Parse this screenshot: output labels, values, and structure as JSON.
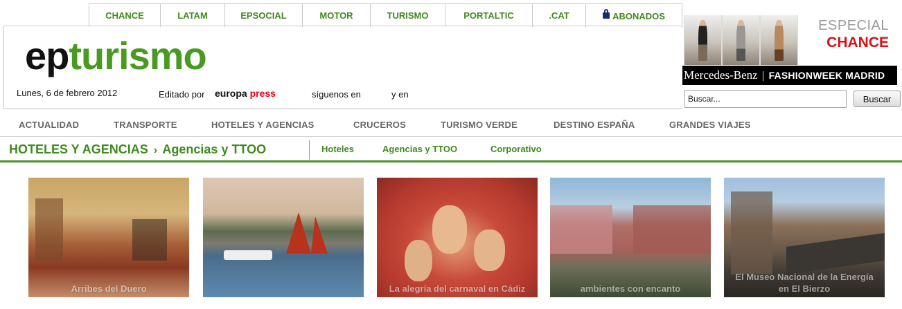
{
  "top_tabs": [
    {
      "label": "CHANCE"
    },
    {
      "label": "LATAM"
    },
    {
      "label": "EPSOCIAL"
    },
    {
      "label": "MOTOR"
    },
    {
      "label": "TURISMO"
    },
    {
      "label": "PORTALTIC"
    },
    {
      "label": ".CAT"
    },
    {
      "label": "ABONADOS",
      "icon": "lock-icon"
    }
  ],
  "header": {
    "logo_ep": "ep",
    "logo_turismo": "turismo",
    "date": "Lunes, 6 de febrero 2012",
    "edited_by": "Editado por",
    "brand_europa": "europa",
    "brand_press": "press",
    "follow_us": "síguenos en",
    "and_in": "y en"
  },
  "ad": {
    "especial": "ESPECIAL",
    "chance": "CHANCE",
    "sponsor": "Mercedes-Benz",
    "separator": "|",
    "event": "FASHIONWEEK MADRID"
  },
  "search": {
    "value": "Buscar...",
    "button_label": "Buscar"
  },
  "main_nav": [
    {
      "label": "ACTUALIDAD"
    },
    {
      "label": "TRANSPORTE"
    },
    {
      "label": "HOTELES Y AGENCIAS"
    },
    {
      "label": "CRUCEROS"
    },
    {
      "label": "TURISMO VERDE"
    },
    {
      "label": "DESTINO ESPAÑA"
    },
    {
      "label": "GRANDES VIAJES"
    }
  ],
  "section": {
    "parent": "HOTELES Y AGENCIAS",
    "chevron": "›",
    "current": "Agencias y TTOO",
    "subnav": [
      {
        "label": "Hoteles"
      },
      {
        "label": "Agencias y TTOO"
      },
      {
        "label": "Corporativo"
      }
    ]
  },
  "thumbnails": [
    {
      "caption": "Arribes del Duero"
    },
    {
      "caption": ""
    },
    {
      "caption": "La alegría del carnaval en Cádiz"
    },
    {
      "caption": "ambientes con encanto"
    },
    {
      "caption": "El Museo Nacional de la Energía en El Bierzo"
    }
  ],
  "colors": {
    "brand_green": "#3f8a1e",
    "logo_green": "#4a9a22",
    "press_red": "#e0001a",
    "chance_red": "#d8101a"
  }
}
